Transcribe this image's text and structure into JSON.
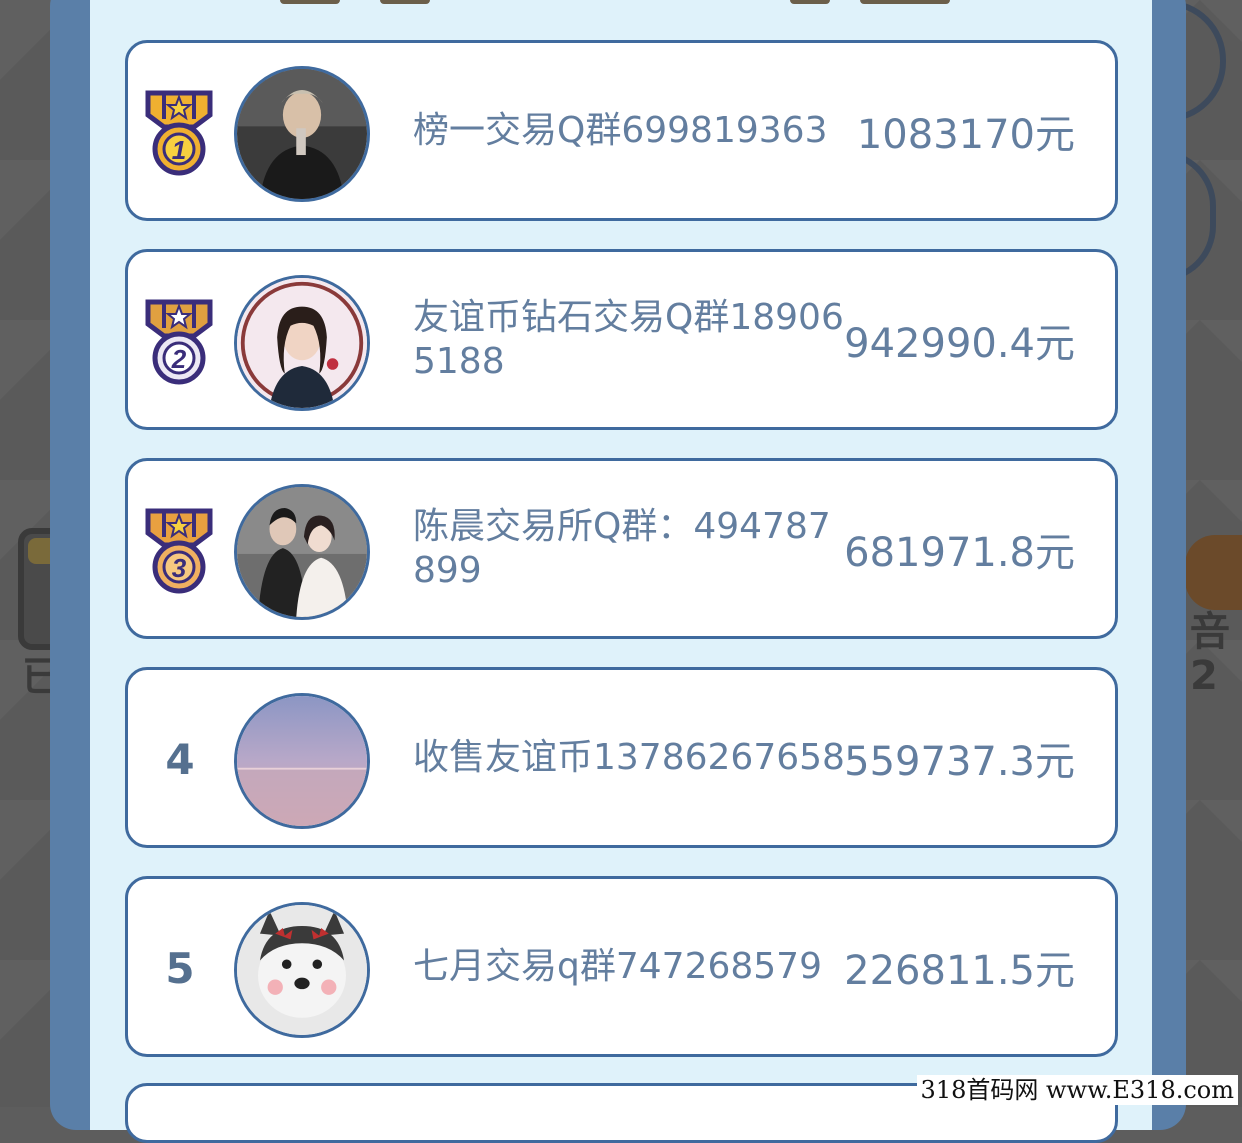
{
  "leaderboard": {
    "rows": [
      {
        "rank": "1",
        "name": "榜一交易Q群699819363",
        "amount": "1083170元"
      },
      {
        "rank": "2",
        "name": "友谊币钻石交易Q群189065188",
        "amount": "942990.4元"
      },
      {
        "rank": "3",
        "name": "陈晨交易所Q群：494787899",
        "amount": "681971.8元"
      },
      {
        "rank": "4",
        "name": "收售友谊币13786267658",
        "amount": "559737.3元"
      },
      {
        "rank": "5",
        "name": "七月交易q群747268579",
        "amount": "226811.5元"
      }
    ]
  },
  "colors": {
    "panel_frame": "#5a7fa8",
    "panel_background": "#dff2fa",
    "row_border": "#3f6a9e",
    "text": "#637e9f",
    "medal_gold": "#f0b030",
    "medal_purple": "#3a2d7a"
  },
  "icons": {
    "rank1": "gold-medal-1-icon",
    "rank2": "medal-2-icon",
    "rank3": "medal-3-icon"
  },
  "watermark": "318首码网 www.E318.com"
}
